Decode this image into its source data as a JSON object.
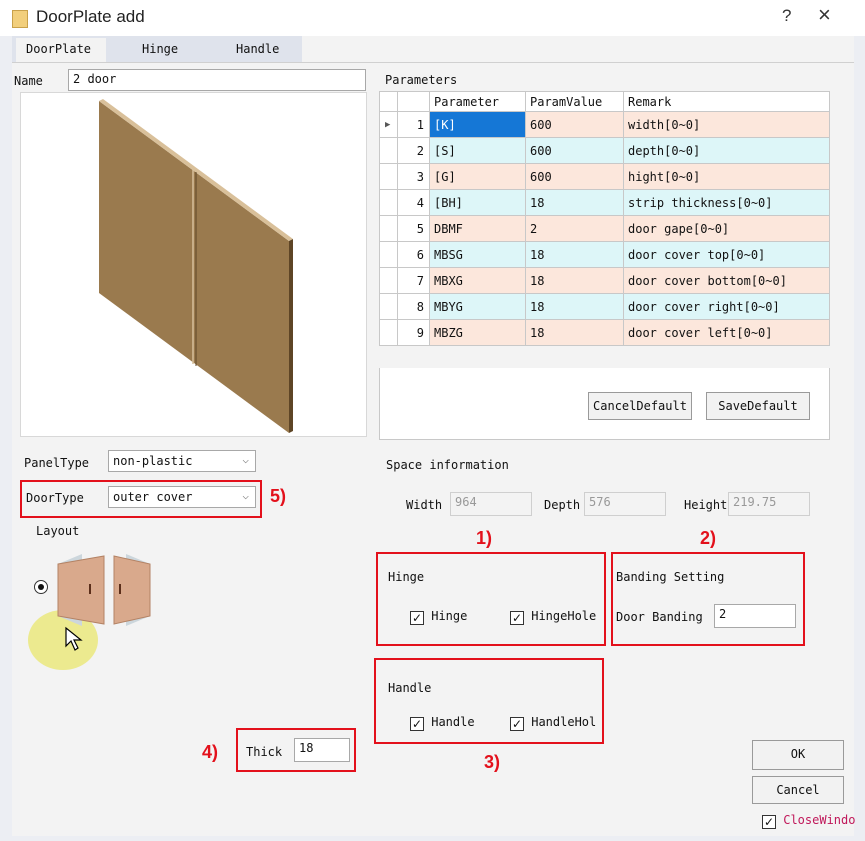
{
  "window": {
    "title": "DoorPlate add",
    "help": "?",
    "close": "×"
  },
  "tabs": [
    "DoorPlate",
    "Hinge",
    "Handle"
  ],
  "name": {
    "label": "Name",
    "value": "2 door"
  },
  "parameters": {
    "label": "Parameters",
    "columns": [
      "Parameter",
      "ParamValue",
      "Remark"
    ],
    "rows": [
      {
        "num": "1",
        "param": "[K]",
        "value": "600",
        "remark": "width[0~0]"
      },
      {
        "num": "2",
        "param": "[S]",
        "value": "600",
        "remark": "depth[0~0]"
      },
      {
        "num": "3",
        "param": "[G]",
        "value": "600",
        "remark": "hight[0~0]"
      },
      {
        "num": "4",
        "param": "[BH]",
        "value": "18",
        "remark": "strip thickness[0~0]"
      },
      {
        "num": "5",
        "param": "DBMF",
        "value": "2",
        "remark": "door gape[0~0]"
      },
      {
        "num": "6",
        "param": "MBSG",
        "value": "18",
        "remark": "door cover top[0~0]"
      },
      {
        "num": "7",
        "param": "MBXG",
        "value": "18",
        "remark": "door cover bottom[0~0]"
      },
      {
        "num": "8",
        "param": "MBYG",
        "value": "18",
        "remark": "door cover right[0~0]"
      },
      {
        "num": "9",
        "param": "MBZG",
        "value": "18",
        "remark": "door cover left[0~0]"
      }
    ],
    "cancel_default": "CancelDefault",
    "save_default": "SaveDefault"
  },
  "panel_type": {
    "label": "PanelType",
    "value": "non-plastic"
  },
  "door_type": {
    "label": "DoorType",
    "value": "outer cover"
  },
  "layout": {
    "label": "Layout"
  },
  "space": {
    "label": "Space information",
    "width_label": "Width",
    "width": "964",
    "depth_label": "Depth",
    "depth": "576",
    "height_label": "Height",
    "height": "219.75"
  },
  "hinge": {
    "label": "Hinge",
    "hinge_cb": "Hinge",
    "hinge_hole_cb": "HingeHole"
  },
  "banding": {
    "label": "Banding Setting",
    "door_banding_label": "Door Banding",
    "door_banding": "2"
  },
  "handle": {
    "label": "Handle",
    "handle_cb": "Handle",
    "handle_hole_cb": "HandleHol"
  },
  "thick": {
    "label": "Thick",
    "value": "18"
  },
  "buttons": {
    "ok": "OK",
    "cancel": "Cancel",
    "close_window": "CloseWindo"
  },
  "annotations": [
    "1)",
    "2)",
    "3)",
    "4)",
    "5)"
  ],
  "colors": {
    "annotation": "#e3101b",
    "selection": "#1577d6",
    "row_odd": "#fce7dc",
    "row_even": "#ddf6f8"
  }
}
